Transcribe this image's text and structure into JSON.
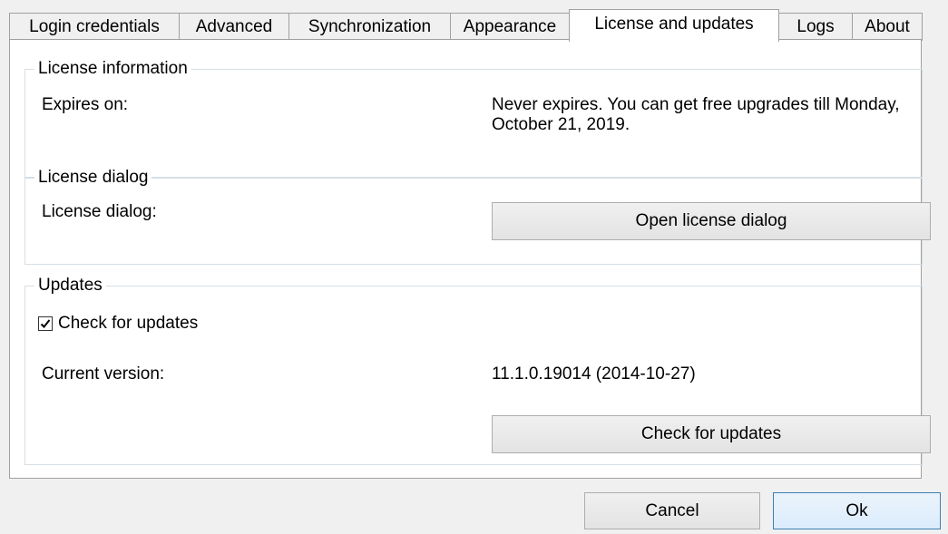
{
  "tabs": [
    {
      "label": "Login credentials",
      "active": false
    },
    {
      "label": "Advanced",
      "active": false
    },
    {
      "label": "Synchronization",
      "active": false
    },
    {
      "label": "Appearance",
      "active": false
    },
    {
      "label": "License and updates",
      "active": true
    },
    {
      "label": "Logs",
      "active": false
    },
    {
      "label": "About",
      "active": false
    }
  ],
  "license_information": {
    "legend": "License information",
    "expires_label": "Expires on:",
    "expires_value": "Never expires. You can get free upgrades till Monday, October 21, 2019."
  },
  "license_dialog": {
    "legend": "License dialog",
    "label": "License dialog:",
    "button": "Open license dialog"
  },
  "updates": {
    "legend": "Updates",
    "check_label": "Check for updates",
    "checked": true,
    "version_label": "Current version:",
    "version_value": "11.1.0.19014 (2014-10-27)",
    "button": "Check for updates"
  },
  "footer": {
    "cancel": "Cancel",
    "ok": "Ok"
  },
  "colors": {
    "primary_border": "#3c7fb1",
    "group_border": "#d5dfe5"
  }
}
